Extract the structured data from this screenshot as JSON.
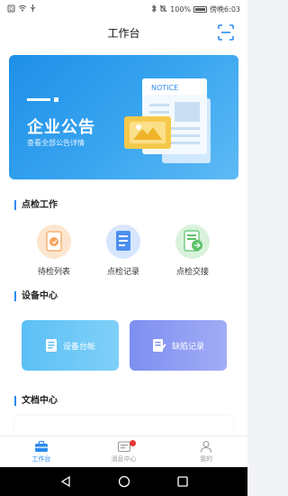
{
  "status_bar": {
    "battery": "100%",
    "carrier_time": "傍晚6:03"
  },
  "header": {
    "title": "工作台"
  },
  "banner": {
    "title": "企业公告",
    "subtitle": "查看全部公告详情",
    "notice_label": "NOTICE"
  },
  "inspection": {
    "title": "点检工作",
    "items": [
      {
        "label": "待检列表",
        "icon": "pending-list-icon",
        "color": "#f5a35a"
      },
      {
        "label": "点检记录",
        "icon": "inspection-record-icon",
        "color": "#4d8ff0"
      },
      {
        "label": "点检交接",
        "icon": "handover-icon",
        "color": "#5cc26a"
      }
    ]
  },
  "device_center": {
    "title": "设备中心",
    "cards": [
      {
        "label": "设备台帐",
        "icon": "ledger-icon",
        "color": "#5cc0f5"
      },
      {
        "label": "缺陷记录",
        "icon": "defect-record-icon",
        "color": "#7d8ff0"
      }
    ]
  },
  "doc_center": {
    "title": "文档中心"
  },
  "tabbar": {
    "tabs": [
      {
        "label": "工作台",
        "icon": "briefcase-icon",
        "active": true
      },
      {
        "label": "消息中心",
        "icon": "message-icon",
        "active": false,
        "badge": true
      },
      {
        "label": "我的",
        "icon": "user-icon",
        "active": false
      }
    ]
  },
  "colors": {
    "accent": "#2d8cf0",
    "banner": "#1f8fe8",
    "badge": "#e53935"
  }
}
